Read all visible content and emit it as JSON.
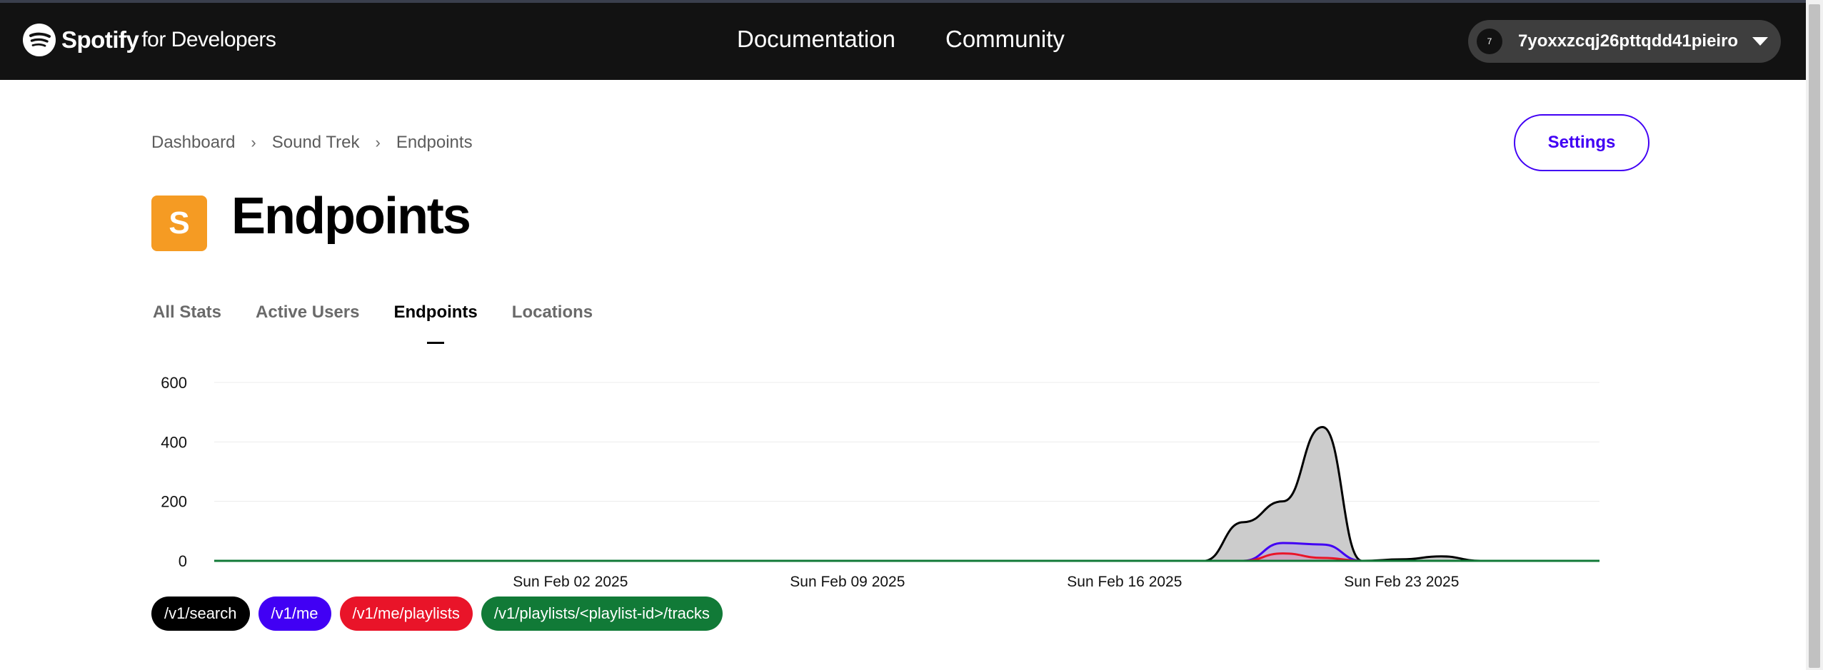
{
  "navbar": {
    "brand_name": "Spotify",
    "brand_sub": "for Developers",
    "links": [
      "Documentation",
      "Community"
    ],
    "user": {
      "avatar_text": "7",
      "name": "7yoxxzcqj26pttqdd41pieiro"
    }
  },
  "breadcrumb": [
    "Dashboard",
    "Sound Trek",
    "Endpoints"
  ],
  "settings_label": "Settings",
  "app_icon_letter": "S",
  "page_title": "Endpoints",
  "tabs": [
    {
      "label": "All Stats",
      "active": false
    },
    {
      "label": "Active Users",
      "active": false
    },
    {
      "label": "Endpoints",
      "active": true
    },
    {
      "label": "Locations",
      "active": false
    }
  ],
  "chart_data": {
    "type": "area",
    "yticks": [
      0,
      200,
      400,
      600
    ],
    "ylim": [
      0,
      600
    ],
    "xlim": [
      "2025-01-24",
      "2025-02-28"
    ],
    "xticks": [
      {
        "date": "2025-02-02",
        "label": "Sun Feb 02 2025"
      },
      {
        "date": "2025-02-09",
        "label": "Sun Feb 09 2025"
      },
      {
        "date": "2025-02-16",
        "label": "Sun Feb 16 2025"
      },
      {
        "date": "2025-02-23",
        "label": "Sun Feb 23 2025"
      }
    ],
    "grid": true,
    "legend_position": "bottom-left",
    "series": [
      {
        "name": "/v1/search",
        "color": "#000000",
        "fill": "#cccccc",
        "x": [
          "2025-01-24",
          "2025-02-18",
          "2025-02-19",
          "2025-02-20",
          "2025-02-21",
          "2025-02-22",
          "2025-02-23",
          "2025-02-24",
          "2025-02-25",
          "2025-02-28"
        ],
        "y": [
          0,
          0,
          130,
          200,
          450,
          0,
          5,
          15,
          0,
          0
        ]
      },
      {
        "name": "/v1/me",
        "color": "#4100f4",
        "fill": "#a08cf0",
        "x": [
          "2025-01-24",
          "2025-02-19",
          "2025-02-20",
          "2025-02-21",
          "2025-02-22",
          "2025-02-28"
        ],
        "y": [
          0,
          0,
          60,
          55,
          0,
          0
        ]
      },
      {
        "name": "/v1/me/playlists",
        "color": "#e91429",
        "fill": "#f28a95",
        "x": [
          "2025-01-24",
          "2025-02-19",
          "2025-02-20",
          "2025-02-21",
          "2025-02-22",
          "2025-02-28"
        ],
        "y": [
          0,
          0,
          25,
          10,
          0,
          0
        ]
      },
      {
        "name": "/v1/playlists/<playlist-id>/tracks",
        "color": "#117a37",
        "fill": "#117a37",
        "x": [
          "2025-01-24",
          "2025-02-28"
        ],
        "y": [
          0,
          0
        ]
      }
    ]
  }
}
